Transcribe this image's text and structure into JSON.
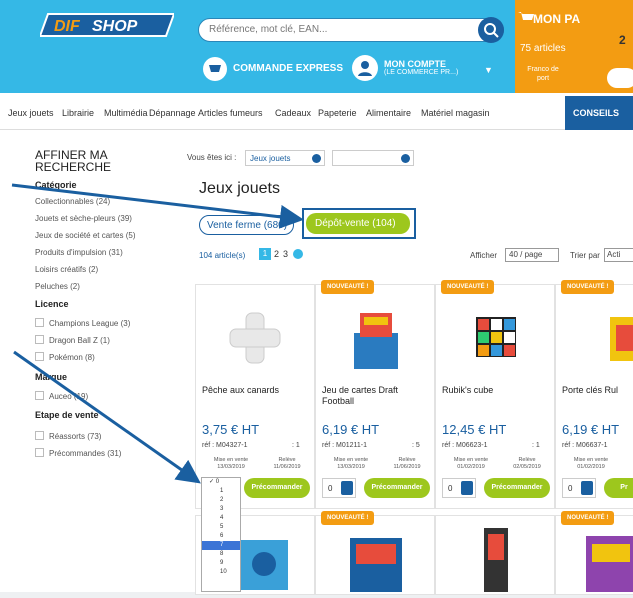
{
  "header": {
    "logo_left": "DIF",
    "logo_right": "SHOP",
    "search_placeholder": "Référence, mot clé, EAN...",
    "express": "COMMANDE EXPRESS",
    "account": "MON COMPTE",
    "account_sub": "(LE COMMERCE PR...)",
    "cart_title": "MON PA",
    "cart_count": "2",
    "cart_articles": "75 articles",
    "cart_franco": "Franco de port"
  },
  "nav": {
    "items": [
      "Jeux jouets",
      "Librairie",
      "Multimédia",
      "Dépannage",
      "Articles fumeurs",
      "Cadeaux",
      "Papeterie",
      "Alimentaire",
      "Matériel magasin"
    ],
    "conseils": "CONSEILS"
  },
  "sidebar": {
    "title": "AFFINER MA RECHERCHE",
    "categorie": "Catégorie",
    "categories": [
      "Collectionnables (24)",
      "Jouets et sèche-pleurs (39)",
      "Jeux de société et cartes (5)",
      "Produits d'impulsion (31)",
      "Loisirs créatifs (2)",
      "Peluches (2)"
    ],
    "licence": "Licence",
    "licences": [
      "Champions League (3)",
      "Dragon Ball Z (1)",
      "Pokémon (8)"
    ],
    "marque": "Marque",
    "marques": [
      "Auceo (19)"
    ],
    "etape": "Etape de vente",
    "etapes": [
      "Réassorts (73)",
      "Précommandes (31)"
    ]
  },
  "main": {
    "crumb_label": "Vous êtes ici :",
    "crumb_value": "Jeux jouets",
    "title": "Jeux jouets",
    "tab_vente": "Vente ferme (680)",
    "tab_depot": "Dépôt-vente (104)",
    "count": "104 article(s)",
    "pages": [
      "1",
      "2",
      "3"
    ],
    "afficher": "Afficher",
    "per_page": "40 / page",
    "trier": "Trier par",
    "trier_val": "Acti"
  },
  "products": [
    {
      "badge": "",
      "name": "Pêche aux canards",
      "price": "3,75 € HT",
      "ref": "réf : M04327-1",
      "qty": ": 1",
      "date1_l": "Mise en vente",
      "date1": "13/03/2019",
      "date2_l": "Relève",
      "date2": "11/06/2019",
      "qtyval": "0",
      "btn": "Précommander"
    },
    {
      "badge": "NOUVEAUTÉ",
      "name": "Jeu de cartes Draft Football",
      "price": "6,19 € HT",
      "ref": "réf : M01211-1",
      "qty": ": 5",
      "date1_l": "Mise en vente",
      "date1": "13/03/2019",
      "date2_l": "Relève",
      "date2": "11/06/2019",
      "qtyval": "0",
      "btn": "Précommander"
    },
    {
      "badge": "NOUVEAUTÉ",
      "name": "Rubik's cube",
      "price": "12,45 € HT",
      "ref": "réf : M06623-1",
      "qty": ": 1",
      "date1_l": "Mise en vente",
      "date1": "01/02/2019",
      "date2_l": "Relève",
      "date2": "02/05/2019",
      "qtyval": "0",
      "btn": "Précommander"
    },
    {
      "badge": "NOUVEAUTÉ",
      "name": "Porte clés Rul",
      "price": "6,19 € HT",
      "ref": "réf : M06637-1",
      "qty": "",
      "date1_l": "Mise en vente",
      "date1": "01/02/2019",
      "date2_l": "",
      "date2": "",
      "qtyval": "0",
      "btn": "Pr"
    }
  ],
  "row2_badges": [
    "",
    "NOUVEAUTÉ",
    "",
    "NOUVEAUTÉ"
  ],
  "dropdown": [
    "0",
    "1",
    "2",
    "3",
    "4",
    "5",
    "6",
    "7",
    "8",
    "9",
    "10"
  ],
  "dropdown_selected": "7",
  "colors": {
    "header": "#35b8e6",
    "orange": "#f39c12",
    "navy": "#1a5fa0",
    "green": "#9dc71d"
  }
}
